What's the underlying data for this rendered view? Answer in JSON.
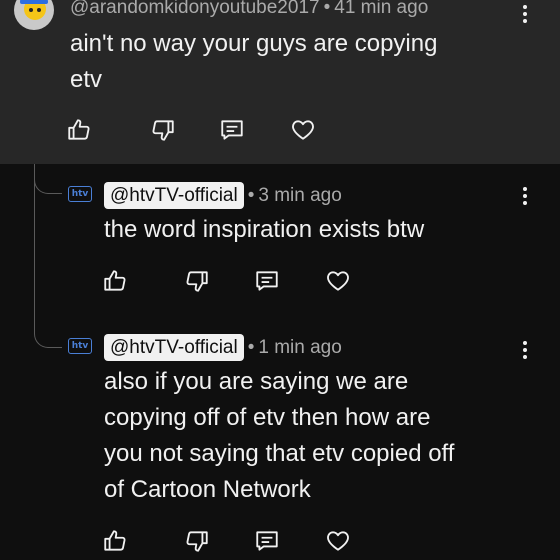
{
  "comments": [
    {
      "handle": "@arandomkidonyoutube2017",
      "time": "41 min ago",
      "text_lines": [
        "ain't no way your guys are copying",
        "etv"
      ]
    }
  ],
  "replies": [
    {
      "avatar_label": "htv",
      "handle": "@htvTV-official",
      "time": "3 min ago",
      "text_lines": [
        "the word inspiration exists btw"
      ]
    },
    {
      "avatar_label": "htv",
      "handle": "@htvTV-official",
      "time": "1 min ago",
      "text_lines": [
        "also if you are saying we are",
        "copying off of etv then how are",
        "you not saying that etv copied off",
        "of Cartoon Network"
      ]
    }
  ],
  "separator": "•",
  "icons": [
    "thumbs-up-icon",
    "thumbs-down-icon",
    "reply-icon",
    "heart-icon",
    "more-options-icon"
  ],
  "colors": {
    "top_comment_bg": "#272727",
    "page_bg": "#0f0f0f",
    "text": "#f1f1f1",
    "meta": "#aaaaaa",
    "pill_bg": "#f1f1f1"
  }
}
